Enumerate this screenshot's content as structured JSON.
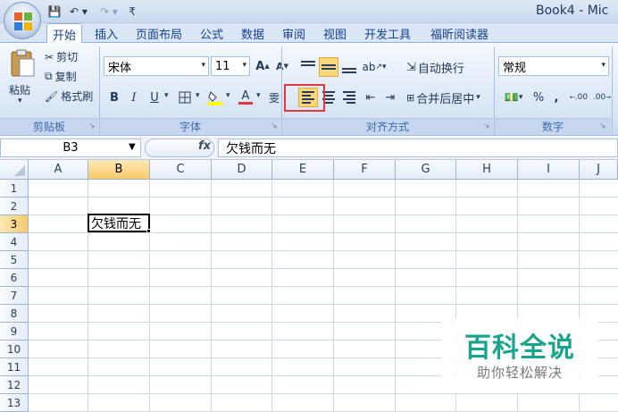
{
  "window": {
    "title": "Book4 - Mic"
  },
  "quick_access": {
    "save": "💾",
    "undo": "↶ ▾",
    "redo": "↷ ▾",
    "more": "₹"
  },
  "tabs": [
    "开始",
    "插入",
    "页面布局",
    "公式",
    "数据",
    "审阅",
    "视图",
    "开发工具",
    "福昕阅读器"
  ],
  "ribbon": {
    "clipboard": {
      "label": "剪贴板",
      "paste": "粘贴",
      "cut": "剪切",
      "copy": "复制",
      "format_painter": "格式刷"
    },
    "font": {
      "label": "字体",
      "name": "宋体",
      "size": "11",
      "bold": "B",
      "italic": "I",
      "underline": "U",
      "grow": "A",
      "shrink": "A",
      "wen": "雯"
    },
    "alignment": {
      "label": "对齐方式",
      "wrap_text": "自动换行",
      "merge_center": "合并后居中"
    },
    "number": {
      "label": "数字",
      "format": "常规",
      "percent": "%",
      "comma": ",",
      "inc_decimal": ".00",
      "dec_decimal": ".00"
    }
  },
  "formula_bar": {
    "name_box": "B3",
    "fx": "fx",
    "content": "欠钱而无"
  },
  "columns": [
    "A",
    "B",
    "C",
    "D",
    "E",
    "F",
    "G",
    "H",
    "I",
    "J"
  ],
  "rows": [
    "1",
    "2",
    "3",
    "4",
    "5",
    "6",
    "7",
    "8",
    "9",
    "10",
    "11",
    "12",
    "13"
  ],
  "active_cell": {
    "ref": "B3",
    "value": "欠钱而无"
  },
  "watermark": {
    "title": "百科全说",
    "subtitle": "助你轻松解决"
  },
  "colors": {
    "ribbon": "#dbe6f4",
    "highlight": "#e0383e",
    "watermark": "#1aa58a",
    "selected_header": "#f8c96a"
  }
}
